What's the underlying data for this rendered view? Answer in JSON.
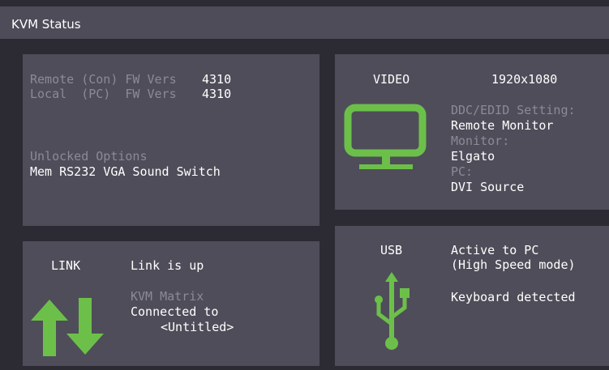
{
  "window": {
    "title": "KVM Status"
  },
  "firmware": {
    "remote_label": "Remote (Con) FW Vers",
    "remote_value": "4310",
    "local_label": "Local  (PC)  FW Vers",
    "local_value": "4310"
  },
  "options": {
    "label": "Unlocked Options",
    "value": "Mem RS232 VGA Sound Switch"
  },
  "video": {
    "heading": "VIDEO",
    "resolution": "1920x1080",
    "ddc_label": "DDC/EDID Setting:",
    "ddc_value": "Remote Monitor",
    "monitor_label": "Monitor:",
    "monitor_value": "Elgato",
    "pc_label": "PC:",
    "pc_value": "DVI Source",
    "icon": "monitor-icon",
    "accent": "#6cc04a"
  },
  "link": {
    "heading": "LINK",
    "status": "Link is up",
    "matrix_label": "KVM Matrix",
    "connected_label": "Connected to",
    "connected_value": "<Untitled>",
    "icon": "up-down-arrows-icon",
    "accent": "#6cc04a"
  },
  "usb": {
    "heading": "USB",
    "status_line1": "Active to PC",
    "status_line2": "(High Speed mode)",
    "keyboard": "Keyboard detected",
    "icon": "usb-icon",
    "accent": "#6cc04a"
  }
}
